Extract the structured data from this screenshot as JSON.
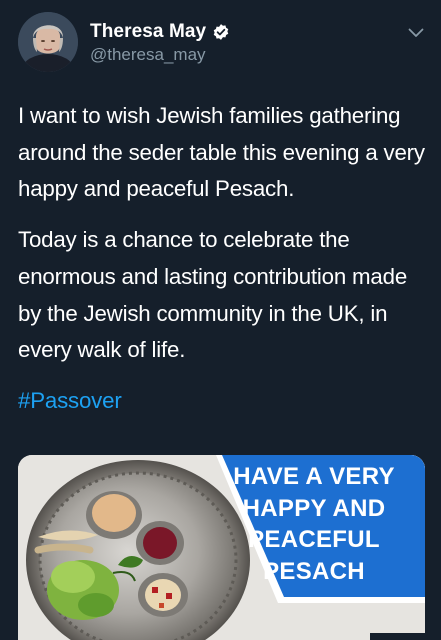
{
  "user": {
    "display_name": "Theresa May",
    "handle": "@theresa_may",
    "verified": true
  },
  "icons": {
    "verified": "verified-badge-icon",
    "menu": "chevron-down-icon"
  },
  "tweet": {
    "paragraph_1": "I want to wish Jewish families gathering around the seder table this evening a very happy and peaceful Pesach.",
    "paragraph_2": "Today is a chance to celebrate the enormous and lasting contribution made by the Jewish community in the UK, in every walk of life.",
    "hashtag": "#Passover"
  },
  "media": {
    "lines": [
      "HAVE A VERY",
      "HAPPY AND",
      "PEACEFUL",
      "PESACH"
    ]
  },
  "colors": {
    "background": "#151f2b",
    "text": "#ffffff",
    "secondary": "#8899a6",
    "link": "#1da1f2",
    "banner_blue": "#1d6fd1"
  }
}
